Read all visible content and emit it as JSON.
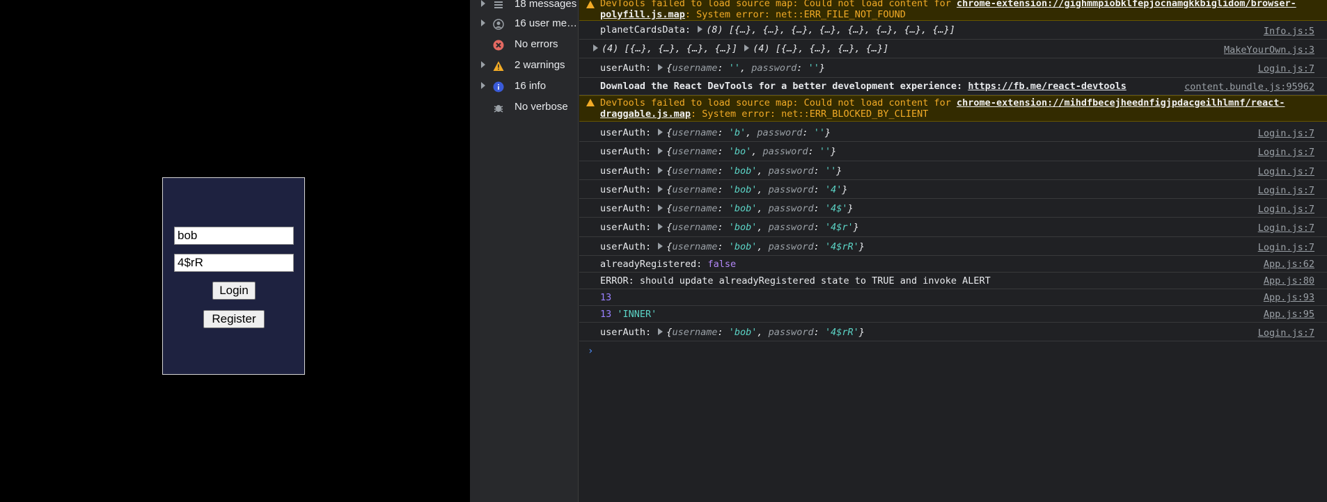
{
  "app": {
    "username_value": "bob",
    "password_value": "4$rR",
    "login_label": "Login",
    "register_label": "Register"
  },
  "sidebar": {
    "items": [
      {
        "label": "18 messages",
        "icon": "list-icon",
        "has_arrow": true
      },
      {
        "label": "16 user me…",
        "icon": "user-icon",
        "has_arrow": true
      },
      {
        "label": "No errors",
        "icon": "error-icon",
        "has_arrow": false
      },
      {
        "label": "2 warnings",
        "icon": "warning-icon",
        "has_arrow": true
      },
      {
        "label": "16 info",
        "icon": "info-icon",
        "has_arrow": true
      },
      {
        "label": "No verbose",
        "icon": "bug-icon",
        "has_arrow": false
      }
    ]
  },
  "console": {
    "warn1": {
      "prefix": "DevTools failed to load source map: Could not load content for ",
      "link": "chrome-extension://gighmmpiobklfepjocnamgkkbiglidom/browser-polyfill.js.map",
      "suffix": ": System error: net::ERR_FILE_NOT_FOUND"
    },
    "planet": {
      "label": "planetCardsData:",
      "count": "(8)",
      "items": "[{…}, {…}, {…}, {…}, {…}, {…}, {…}, {…}]",
      "source": "Info.js:5"
    },
    "arrays": {
      "a_count": "(4)",
      "a_items": "[{…}, {…}, {…}, {…}]",
      "b_count": "(4)",
      "b_items": "[{…}, {…}, {…}, {…}]",
      "source": "MakeYourOwn.js:3"
    },
    "auth_rows": [
      {
        "label": "userAuth:",
        "username": "''",
        "password": "''",
        "source": "Login.js:7"
      }
    ],
    "react_devtools": {
      "text": "Download the React DevTools for a better development experience: ",
      "link": "https://fb.me/react-devtools",
      "source": "content.bundle.js:95962"
    },
    "warn2": {
      "prefix": "DevTools failed to load source map: Could not load content for ",
      "link": "chrome-extension://mihdfbecejheednfigjpdacgeilhlmnf/react-draggable.js.map",
      "suffix": ": System error: net::ERR_BLOCKED_BY_CLIENT"
    },
    "auth_rows2": [
      {
        "label": "userAuth:",
        "username": "'b'",
        "password": "''",
        "source": "Login.js:7"
      },
      {
        "label": "userAuth:",
        "username": "'bo'",
        "password": "''",
        "source": "Login.js:7"
      },
      {
        "label": "userAuth:",
        "username": "'bob'",
        "password": "''",
        "source": "Login.js:7"
      },
      {
        "label": "userAuth:",
        "username": "'bob'",
        "password": "'4'",
        "source": "Login.js:7"
      },
      {
        "label": "userAuth:",
        "username": "'bob'",
        "password": "'4$'",
        "source": "Login.js:7"
      },
      {
        "label": "userAuth:",
        "username": "'bob'",
        "password": "'4$r'",
        "source": "Login.js:7"
      },
      {
        "label": "userAuth:",
        "username": "'bob'",
        "password": "'4$rR'",
        "source": "Login.js:7"
      }
    ],
    "already": {
      "label": "alreadyRegistered:",
      "value": "false",
      "source": "App.js:62"
    },
    "error_line": {
      "text": "ERROR: should update alreadyRegistered state to TRUE and invoke ALERT",
      "source": "App.js:80"
    },
    "num_line": {
      "value": "13",
      "source": "App.js:93"
    },
    "inner_line": {
      "value": "13",
      "text": "'INNER'",
      "source": "App.js:95"
    },
    "last_auth": {
      "label": "userAuth:",
      "username": "'bob'",
      "password": "'4$rR'",
      "source": "Login.js:7"
    },
    "prompt": "›",
    "username_key": "username",
    "password_key": "password"
  }
}
